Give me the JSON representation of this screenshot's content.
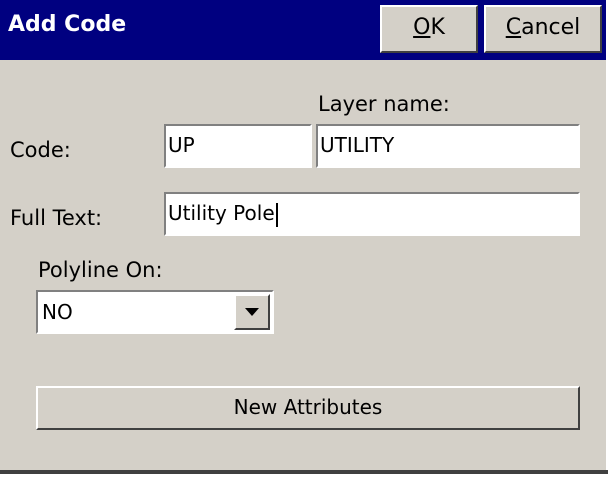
{
  "window": {
    "title": "Add Code",
    "ok_label": "OK",
    "ok_mnemonic": "O",
    "ok_rest": "K",
    "cancel_label": "Cancel",
    "cancel_mnemonic": "C",
    "cancel_rest": "ancel"
  },
  "form": {
    "layer_name_label": "Layer name:",
    "code_label": "Code:",
    "code_value": "UP",
    "layer_name_value": "UTILITY",
    "full_text_label": "Full Text:",
    "full_text_value": "Utility Pole",
    "polyline_label": "Polyline On:",
    "polyline_value": "NO",
    "new_attributes_button": "New Attributes"
  },
  "icons": {
    "dropdown_arrow": "chevron-down-icon"
  },
  "colors": {
    "titlebar": "#000080",
    "dialog_bg": "#d4d0c8",
    "field_bg": "#ffffff"
  }
}
